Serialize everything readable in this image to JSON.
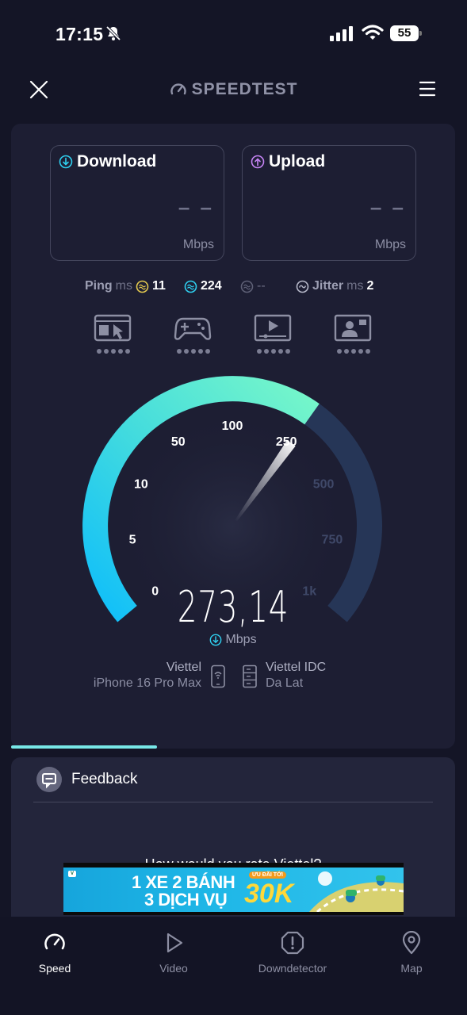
{
  "status_bar": {
    "time": "17:15",
    "battery": "55"
  },
  "header": {
    "brand": "SPEEDTEST"
  },
  "download": {
    "label": "Download",
    "value": "– –",
    "unit": "Mbps"
  },
  "upload": {
    "label": "Upload",
    "value": "– –",
    "unit": "Mbps"
  },
  "ping": {
    "label": "Ping",
    "unit": "ms",
    "idle": "11",
    "download": "224",
    "upload": "--",
    "jitter_label": "Jitter",
    "jitter_unit": "ms",
    "jitter": "2"
  },
  "gauge": {
    "ticks": [
      "0",
      "5",
      "10",
      "50",
      "100",
      "250",
      "500",
      "750",
      "1k"
    ],
    "current_mbps": 273.14,
    "reading": "273,14",
    "unit": "Mbps"
  },
  "connection": {
    "provider": "Viettel",
    "device": "iPhone 16 Pro Max",
    "server_name": "Viettel IDC",
    "server_location": "Da Lat"
  },
  "feedback": {
    "title": "Feedback",
    "question": "How would you rate Viettel?"
  },
  "ad": {
    "line1": "1 XE 2 BÁNH",
    "line2": "3 DỊCH VỤ",
    "tag": "ƯU ĐÃI TỚI",
    "price": "30K"
  },
  "nav": [
    {
      "label": "Speed",
      "active": true
    },
    {
      "label": "Video",
      "active": false
    },
    {
      "label": "Downdetector",
      "active": false
    },
    {
      "label": "Map",
      "active": false
    }
  ],
  "colors": {
    "background": "#141526",
    "card": "#1d1e33",
    "accent_teal": "#6ff2c8",
    "accent_blue": "#16c8ff",
    "upload_purple": "#c684f5",
    "gauge_track": "#263657"
  }
}
